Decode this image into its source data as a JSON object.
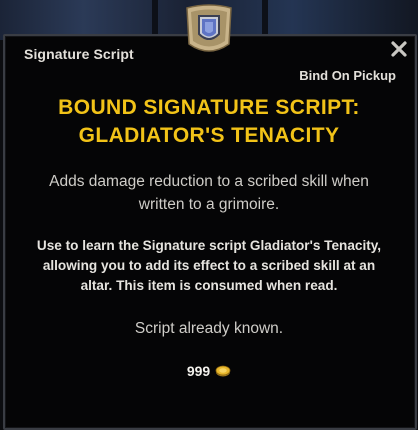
{
  "tooltip": {
    "item_type": "Signature Script",
    "bind_status": "Bind On Pickup",
    "title_line1": "BOUND SIGNATURE SCRIPT:",
    "title_line2": "GLADIATOR'S TENACITY",
    "description_line1": "Adds damage reduction to a scribed skill when",
    "description_line2": "written to a grimoire.",
    "use_line1": "Use to learn the Signature script Gladiator's Tenacity,",
    "use_line2": "allowing you to add its effect to a scribed skill at an",
    "use_line3": "altar. This item is consumed when read.",
    "status": "Script already known.",
    "price": "999",
    "icons": {
      "item": "shield-scroll-icon",
      "close": "close-icon",
      "currency": "gold-coin-icon"
    }
  },
  "colors": {
    "title": "#f2c318",
    "text": "#cfcdc8",
    "background": "#050506",
    "border": "#3a3d44"
  }
}
